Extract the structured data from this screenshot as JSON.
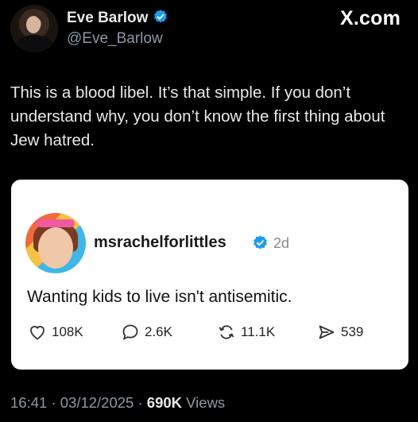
{
  "author": {
    "name": "Eve Barlow",
    "handle": "@Eve_Barlow",
    "verified_icon": "verified-badge-icon"
  },
  "site": "X.com",
  "tweet": {
    "text": "This is a blood libel. It’s that simple. If you don’t understand why, you don’t know the first thing about Jew hatred."
  },
  "quoted_post": {
    "username": "msrachelforlittles",
    "age": "2d",
    "text": "Wanting kids to live isn't antisemitic.",
    "stats": {
      "likes": "108K",
      "replies": "2.6K",
      "reposts": "11.1K",
      "shares": "539"
    }
  },
  "meta": {
    "time": "16:41",
    "date": "03/12/2025",
    "views_count": "690K",
    "views_label": "Views",
    "separator": "·"
  },
  "colors": {
    "background": "#000000",
    "text_primary": "#e7e9ea",
    "text_secondary": "#8b98a5",
    "verified_blue": "#1d9bf0",
    "card_background": "#ffffff"
  }
}
